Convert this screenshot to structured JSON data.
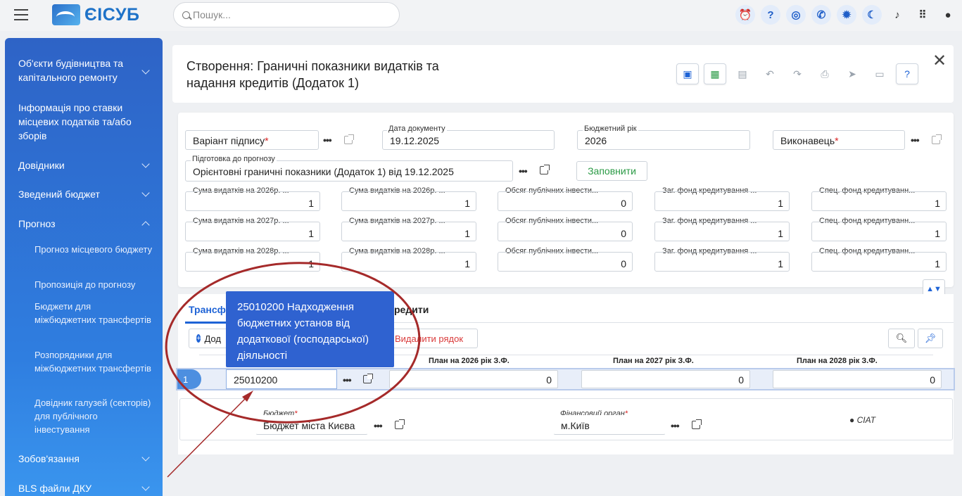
{
  "app": {
    "logo_text": "ЄІСУБ",
    "search_placeholder": "Пошук..."
  },
  "top_icons": [
    "alarm-icon",
    "help-icon",
    "support-icon",
    "phone-icon",
    "settings-icon",
    "theme-moon-icon",
    "bell-icon",
    "apps-grid-icon",
    "user-icon"
  ],
  "sidebar": {
    "items": [
      {
        "label": "Об'єкти будівництва та капітального ремонту"
      },
      {
        "label": "Інформація про ставки місцевих податків та/або зборів"
      },
      {
        "label": "Довідники"
      },
      {
        "label": "Зведений бюджет"
      },
      {
        "label": "Прогноз"
      },
      {
        "label": "Зобов'язання"
      },
      {
        "label": "BLS файли ДКУ"
      }
    ],
    "sub": [
      {
        "label": "Прогноз місцевого бюджету"
      },
      {
        "label": "Пропозиція до прогнозу"
      },
      {
        "label": "Бюджети для міжбюджетних трансфертів"
      },
      {
        "label": "Розпорядники для міжбюджетних трансфертів"
      },
      {
        "label": "Довідник галузей (секторів) для публічного інвестування"
      }
    ]
  },
  "doc": {
    "title": "Створення: Граничні показники видатків та надання кредитів (Додаток 1)"
  },
  "form": {
    "signature_label": "Варіант підпису",
    "date_label": "Дата документу",
    "date_value": "19.12.2025",
    "year_label": "Бюджетний рік",
    "year_value": "2026",
    "executor_label": "Виконавець",
    "prep_label": "Підготовка до прогнозу",
    "prep_value": "Орієнтовні граничні показники (Додаток 1)  від 19.12.2025",
    "fill_button": "Заповнити",
    "grid": [
      [
        {
          "label": "Сума видатків на 2026р. ...",
          "value": "1"
        },
        {
          "label": "Сума видатків на 2026р. ...",
          "value": "1"
        },
        {
          "label": "Обсяг публічних інвести...",
          "value": "0"
        },
        {
          "label": "Заг. фонд кредитування ...",
          "value": "1"
        },
        {
          "label": "Спец. фонд кредитуванн...",
          "value": "1"
        }
      ],
      [
        {
          "label": "Сума видатків на 2027р. ...",
          "value": "1"
        },
        {
          "label": "Сума видатків на 2027р. ...",
          "value": "1"
        },
        {
          "label": "Обсяг публічних інвести...",
          "value": "0"
        },
        {
          "label": "Заг. фонд кредитування ...",
          "value": "1"
        },
        {
          "label": "Спец. фонд кредитуванн...",
          "value": "1"
        }
      ],
      [
        {
          "label": "Сума видатків на 2028р. ...",
          "value": "1"
        },
        {
          "label": "Сума видатків на 2028р. ...",
          "value": "1"
        },
        {
          "label": "Обсяг публічних інвести...",
          "value": "0"
        },
        {
          "label": "Заг. фонд кредитування ...",
          "value": "1"
        },
        {
          "label": "Спец. фонд кредитуванн...",
          "value": "1"
        }
      ]
    ]
  },
  "tabs": {
    "transfers": "Трансф",
    "credits": "редити"
  },
  "table": {
    "add_label": "Дод",
    "delete_label": "Видалити рядок",
    "col_2026": "План на  2026  рік З.Ф.",
    "col_2027": "План на  2027  рік З.Ф.",
    "col_2028": "План на  2028  рік З.Ф.",
    "row": {
      "num": "1",
      "code": "25010200",
      "v2026": "0",
      "v2027": "0",
      "v2028": "0"
    }
  },
  "bottom": {
    "budget_label": "Бюджет",
    "budget_value": "Бюджет міста Києва",
    "fin_label": "Фінансовий орган",
    "fin_value": "м.Київ",
    "user": "CIAT"
  },
  "tooltip": {
    "text": "25010200 Надходження бюджетних установ від додаткової (господарської) діяльності"
  },
  "colors": {
    "accent": "#1e63d6",
    "sidebar": "#2f6fd6",
    "tooltip": "#2f62d0",
    "annotation": "#a52a2a",
    "green": "#2a9a45"
  }
}
